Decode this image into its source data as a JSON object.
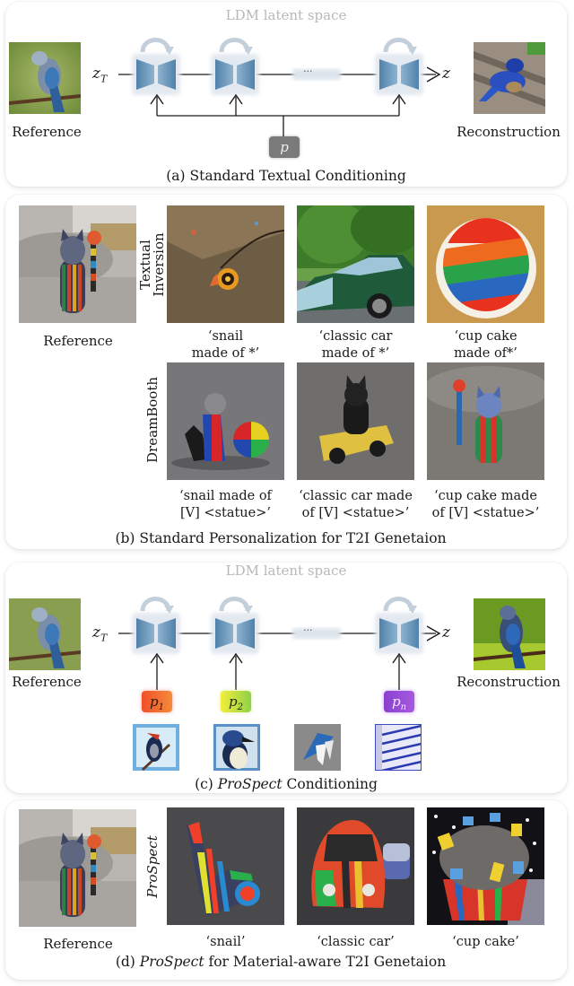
{
  "panel_a": {
    "latent_label": "LDM latent space",
    "input_var": "z",
    "input_sub": "T",
    "output_var": "z",
    "ellipsis": "···",
    "prompt_token": "p",
    "left_label": "Reference",
    "right_label": "Reconstruction",
    "caption": "(a) Standard Textual Conditioning"
  },
  "panel_b": {
    "reference_label": "Reference",
    "row_labels": [
      "Textual Inversion",
      "DreamBooth"
    ],
    "row_label_lines": [
      [
        "Textual",
        "Inversion"
      ],
      [
        "DreamBooth"
      ]
    ],
    "textual_inversion_prompts": [
      [
        "‘snail",
        "made of *’"
      ],
      [
        "‘classic car",
        "made of *’"
      ],
      [
        "‘cup cake",
        "made of*’"
      ]
    ],
    "dreambooth_prompts": [
      [
        "‘snail made of",
        "[V] <statue>’"
      ],
      [
        "‘classic car made",
        "of [V] <statue>’"
      ],
      [
        "‘cup cake made",
        "of [V] <statue>’"
      ]
    ],
    "caption": "(b) Standard Personalization for T2I Genetaion"
  },
  "panel_c": {
    "latent_label": "LDM latent space",
    "input_var": "z",
    "input_sub": "T",
    "output_var": "z",
    "ellipsis": "···",
    "tokens": [
      {
        "var": "p",
        "sub": "1",
        "color_from": "#f0502a",
        "color_to": "#f58a3a"
      },
      {
        "var": "p",
        "sub": "2",
        "color_from": "#f3ee3a",
        "color_to": "#8fd14a"
      },
      {
        "var": "p",
        "sub": "n",
        "color_from": "#8a3fd0",
        "color_to": "#a65ae0"
      }
    ],
    "left_label": "Reference",
    "right_label": "Reconstruction",
    "caption_prefix": "(c) ",
    "caption_em": "ProSpect",
    "caption_suffix": " Conditioning"
  },
  "panel_d": {
    "reference_label": "Reference",
    "row_label": "ProSpect",
    "prompts": [
      "‘snail’",
      "‘classic car’",
      "‘cup cake’"
    ],
    "caption_prefix": "(d) ",
    "caption_em": "ProSpect",
    "caption_suffix": " for Material-aware T2I Genetaion"
  },
  "colors": {
    "unet_fill": "#6f9cbc",
    "unet_halo": "#e3e9f0",
    "loop_arrow": "#c3cfdb",
    "p_box": "#7a7a7a",
    "latent_text": "#b8b8b8"
  }
}
